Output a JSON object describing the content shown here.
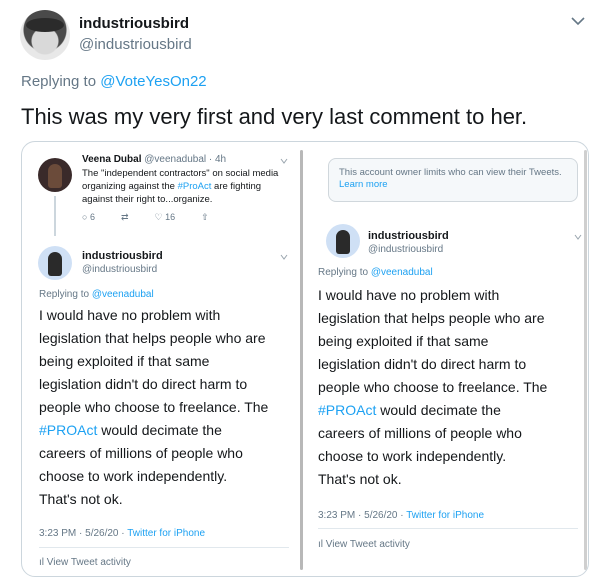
{
  "tweet": {
    "username": "industriousbird",
    "handle": "@industriousbird",
    "replying_prefix": "Replying to ",
    "replying_to": "@VoteYesOn22",
    "text": "This was my very first and very last comment to her."
  },
  "left_panel": {
    "quoted": {
      "name": "Veena Dubal",
      "meta": " @veenadubal · 4h",
      "text_parts": [
        "The \"independent contractors\" on social media organizing against the ",
        "#ProAct",
        " are fighting against their right to...organize."
      ],
      "replies": "6",
      "likes": "16"
    },
    "reply": {
      "name": "industriousbird",
      "handle": "@industriousbird",
      "replying_prefix": "Replying to ",
      "replying_to": "@veenadubal",
      "body_lines": [
        "I would have no problem with",
        "legislation that helps people who are",
        "being exploited if that same",
        "legislation didn't do direct harm to",
        "people who choose to freelance. The"
      ],
      "hashtag": "#PROAct",
      "hashtag_rest": " would decimate the",
      "body_lines_2": [
        "careers of millions of people who",
        "choose to work independently.",
        "That's not ok."
      ],
      "time": "3:23 PM · 5/26/20 · ",
      "source": "Twitter for iPhone",
      "activity": "View Tweet activity"
    }
  },
  "right_panel": {
    "notice_text": "This account owner limits who can view their Tweets. ",
    "notice_link": "Learn more",
    "reply": {
      "name": "industriousbird",
      "handle": "@industriousbird",
      "replying_prefix": "Replying to ",
      "replying_to": "@veenadubal",
      "body_lines": [
        "I would have no problem with",
        "legislation that helps people who are",
        "being exploited if that same",
        "legislation didn't do direct harm to",
        "people who choose to freelance. The"
      ],
      "hashtag": "#PROAct",
      "hashtag_rest": " would decimate the",
      "body_lines_2": [
        "careers of millions of people who",
        "choose to work independently.",
        "That's not ok."
      ],
      "time": "3:23 PM · 5/26/20 · ",
      "source": "Twitter for iPhone",
      "activity": "View Tweet activity"
    }
  },
  "colors": {
    "accent": "#1da1f2",
    "muted": "#657786",
    "text": "#14171a",
    "border": "#ccd6dd"
  },
  "icons": [
    "chevron-down-icon",
    "reply-icon",
    "retweet-icon",
    "like-icon",
    "share-icon",
    "activity-icon"
  ]
}
